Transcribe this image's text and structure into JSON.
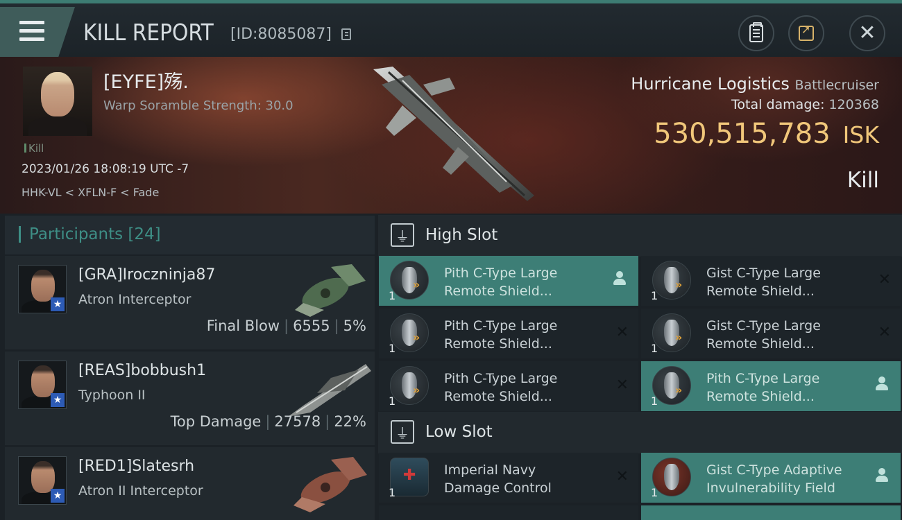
{
  "header": {
    "title": "KILL REPORT",
    "report_id": "[ID:8085087]",
    "icons": [
      "menu-icon",
      "copy-icon",
      "clipboard-icon",
      "share-icon",
      "close-icon"
    ]
  },
  "victim": {
    "name": "[EYFE]殇.",
    "scramble": "Warp Soramble Strength: 30.0",
    "tag": "Kill",
    "datetime": "2023/01/26 18:08:19 UTC -7",
    "location": "HHK-VL < XFLN-F < Fade",
    "ship_name": "Hurricane Logistics",
    "ship_class": "Battlecruiser",
    "damage_label": "Total damage:",
    "damage_value": "120368",
    "isk_value": "530,515,783",
    "isk_unit": "ISK",
    "result": "Kill"
  },
  "participants": {
    "title": "Participants",
    "count": "[24]",
    "rows": [
      {
        "name": "[GRA]Iroczninja87",
        "ship": "Atron Interceptor",
        "role": "Final Blow",
        "damage": "6555",
        "pct": "5%"
      },
      {
        "name": "[REAS]bobbush1",
        "ship": "Typhoon II",
        "role": "Top Damage",
        "damage": "27578",
        "pct": "22%"
      },
      {
        "name": "[RED1]Slatesrh",
        "ship": "Atron II Interceptor",
        "role": "",
        "damage": "",
        "pct": ""
      }
    ]
  },
  "high_slot": {
    "title": "High Slot",
    "modules": [
      {
        "line1": "Pith C-Type Large",
        "line2": "Remote Shield...",
        "qty": "1"
      },
      {
        "line1": "Gist C-Type Large",
        "line2": "Remote Shield...",
        "qty": "1"
      },
      {
        "line1": "Pith C-Type Large",
        "line2": "Remote Shield...",
        "qty": "1"
      },
      {
        "line1": "Gist C-Type Large",
        "line2": "Remote Shield...",
        "qty": "1"
      },
      {
        "line1": "Pith C-Type Large",
        "line2": "Remote Shield...",
        "qty": "1"
      },
      {
        "line1": "Pith C-Type Large",
        "line2": "Remote Shield...",
        "qty": "1"
      }
    ]
  },
  "low_slot": {
    "title": "Low Slot",
    "modules": [
      {
        "line1": "Imperial Navy",
        "line2": "Damage Control",
        "qty": "1"
      },
      {
        "line1": "Gist C-Type Adaptive",
        "line2": "Invulnerability Field",
        "qty": "1"
      }
    ]
  },
  "colors": {
    "accent": "#3d7e76",
    "isk": "#f1c77a",
    "participants": "#3e8f86"
  }
}
